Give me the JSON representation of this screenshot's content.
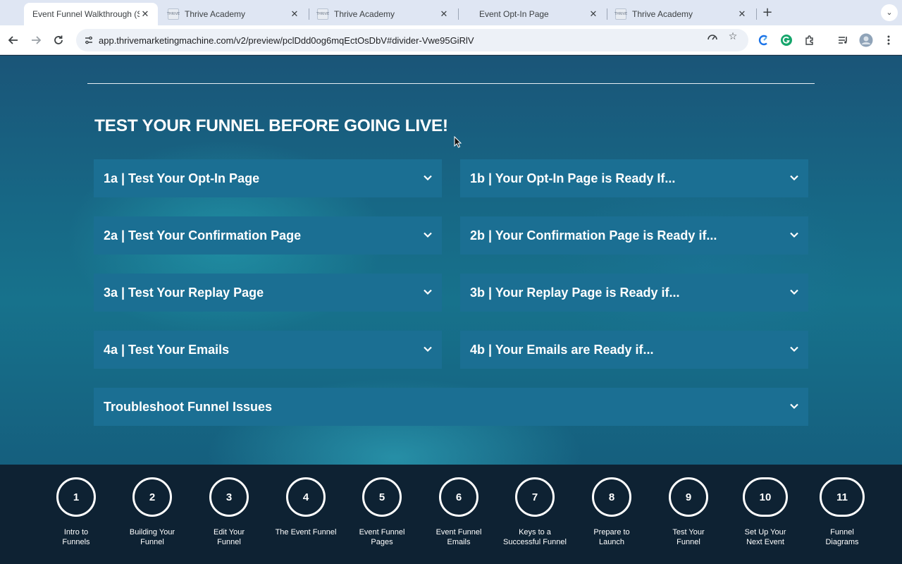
{
  "browser": {
    "tabs": [
      {
        "title": "Event Funnel Walkthrough (ST",
        "favicon": "none",
        "active": true
      },
      {
        "title": "Thrive Academy",
        "favicon": "thrive-logo",
        "active": false
      },
      {
        "title": "Thrive Academy",
        "favicon": "thrive-logo",
        "active": false
      },
      {
        "title": "Event Opt-In Page",
        "favicon": "none",
        "active": false
      },
      {
        "title": "Thrive Academy",
        "favicon": "thrive-logo",
        "active": false
      }
    ],
    "url": "app.thrivemarketingmachine.com/v2/preview/pclDdd0og6mqEctOsDbV#divider-Vwe95GiRlV"
  },
  "page": {
    "headline": "TEST YOUR FUNNEL BEFORE GOING LIVE!",
    "accordions": [
      {
        "label": "1a | Test Your Opt-In Page"
      },
      {
        "label": "1b | Your Opt-In Page is Ready If..."
      },
      {
        "label": "2a | Test Your Confirmation Page"
      },
      {
        "label": "2b | Your Confirmation Page is Ready if..."
      },
      {
        "label": "3a | Test Your Replay Page"
      },
      {
        "label": "3b | Your Replay Page is Ready if..."
      },
      {
        "label": "4a | Test Your Emails"
      },
      {
        "label": "4b | Your Emails are Ready if..."
      },
      {
        "label": "Troubleshoot Funnel Issues"
      }
    ]
  },
  "steps": [
    {
      "number": "1",
      "line1": "Intro to",
      "line2": "Funnels"
    },
    {
      "number": "2",
      "line1": "Building Your",
      "line2": "Funnel"
    },
    {
      "number": "3",
      "line1": "Edit Your",
      "line2": "Funnel"
    },
    {
      "number": "4",
      "line1": "The Event Funnel",
      "line2": ""
    },
    {
      "number": "5",
      "line1": "Event Funnel",
      "line2": "Pages"
    },
    {
      "number": "6",
      "line1": "Event Funnel",
      "line2": "Emails"
    },
    {
      "number": "7",
      "line1": "Keys to a",
      "line2": "Successful Funnel"
    },
    {
      "number": "8",
      "line1": "Prepare to",
      "line2": "Launch"
    },
    {
      "number": "9",
      "line1": "Test Your",
      "line2": "Funnel"
    },
    {
      "number": "10",
      "line1": "Set Up Your",
      "line2": "Next Event"
    },
    {
      "number": "11",
      "line1": "Funnel",
      "line2": "Diagrams"
    }
  ],
  "colors": {
    "accordion_bg": "#1b6f93",
    "footer_bg": "#0e2233",
    "page_bg": "#17728c",
    "text": "#ffffff"
  }
}
